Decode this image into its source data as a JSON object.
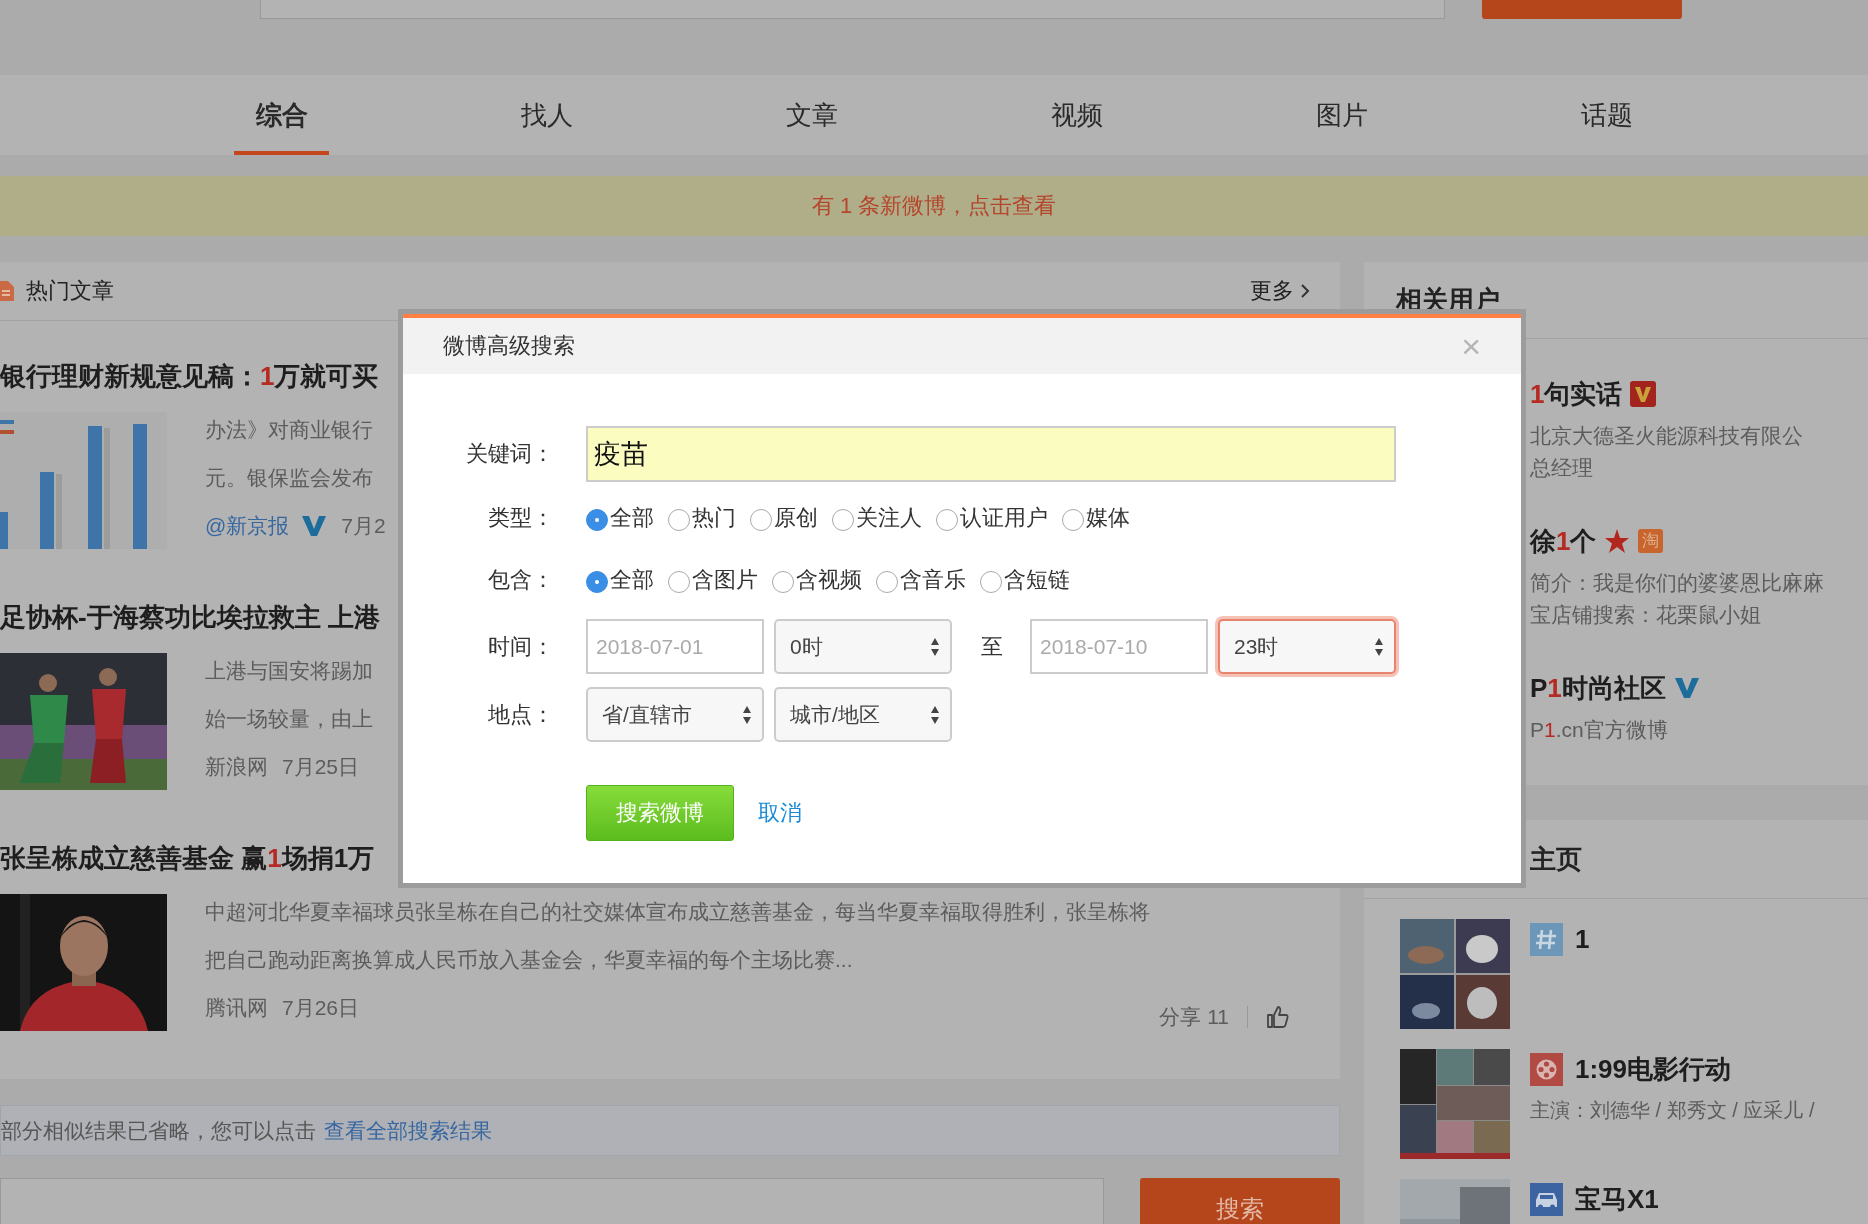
{
  "tabs": [
    {
      "label": "综合",
      "selected": true
    },
    {
      "label": "找人",
      "selected": false
    },
    {
      "label": "文章",
      "selected": false
    },
    {
      "label": "视频",
      "selected": false
    },
    {
      "label": "图片",
      "selected": false
    },
    {
      "label": "话题",
      "selected": false
    }
  ],
  "notice": "有 1 条新微博，点击查看",
  "hot_articles": {
    "title": "热门文章",
    "more": "更多",
    "articles": [
      {
        "title_parts": [
          {
            "text": "银行理财新规意见稿：",
            "highlight": false
          },
          {
            "text": "1",
            "highlight": true
          },
          {
            "text": "万就可买",
            "highlight": false
          }
        ],
        "summary": [
          "办法》对商业银行",
          "元。银保监会发布"
        ],
        "source": {
          "text": "@新京报",
          "kind": "link"
        },
        "verified": true,
        "date": "7月2"
      },
      {
        "title_parts": [
          {
            "text": "足协杯-于海蔡功比埃拉救主 上港",
            "highlight": false
          }
        ],
        "summary": [
          "上港与国安将踢加",
          "始一场较量，由上"
        ],
        "source": {
          "text": "新浪网",
          "kind": "plain"
        },
        "verified": false,
        "date": "7月25日"
      },
      {
        "title_parts": [
          {
            "text": "张呈栋成立慈善基金 赢",
            "highlight": false
          },
          {
            "text": "1",
            "highlight": true
          },
          {
            "text": "场捐1万",
            "highlight": false
          }
        ],
        "summary": [
          "中超河北华夏幸福球员张呈栋在自己的社交媒体宣布成立慈善基金，每当华夏幸福取得胜利，张呈栋将",
          "把自己跑动距离换算成人民币放入基金会，华夏幸福的每个主场比赛..."
        ],
        "source": {
          "text": "腾讯网",
          "kind": "plain"
        },
        "verified": false,
        "date": "7月26日",
        "share": "分享 11"
      }
    ]
  },
  "omitted": {
    "text": "部分相似结果已省略，您可以点击",
    "link": "查看全部搜索结果"
  },
  "bottom_search": {
    "button": "搜索"
  },
  "related_users": {
    "title": "相关用户",
    "users": [
      {
        "name_parts": [
          {
            "text": "1",
            "highlight": true
          },
          {
            "text": "句实话",
            "highlight": false
          }
        ],
        "badges": [
          {
            "kind": "vip"
          }
        ],
        "info": [
          {
            "parts": [
              {
                "text": "北京大德圣火能源科技有限公",
                "highlight": false
              }
            ]
          },
          {
            "parts": [
              {
                "text": "总经理",
                "highlight": false
              }
            ]
          }
        ]
      },
      {
        "name_parts": [
          {
            "text": "徐",
            "highlight": false
          },
          {
            "text": "1",
            "highlight": true
          },
          {
            "text": "个",
            "highlight": false
          }
        ],
        "badges": [
          {
            "kind": "star"
          },
          {
            "kind": "shop",
            "text": "淘"
          }
        ],
        "info": [
          {
            "parts": [
              {
                "text": "简介：我是你们的婆婆恩比麻麻",
                "highlight": false
              }
            ]
          },
          {
            "parts": [
              {
                "text": "宝店铺搜索：花栗鼠小姐",
                "highlight": false
              }
            ]
          }
        ]
      },
      {
        "name_parts": [
          {
            "text": "P",
            "highlight": false
          },
          {
            "text": "1",
            "highlight": true
          },
          {
            "text": "时尚社区",
            "highlight": false
          }
        ],
        "badges": [
          {
            "kind": "verified"
          }
        ],
        "info": [
          {
            "parts": [
              {
                "text": "P",
                "highlight": false
              },
              {
                "text": "1",
                "highlight": true
              },
              {
                "text": ".cn官方微博",
                "highlight": false
              }
            ]
          }
        ]
      }
    ]
  },
  "pages": {
    "title": "主页",
    "items": [
      {
        "kind": "topic",
        "title": "1"
      },
      {
        "kind": "film",
        "title": "1:99电影行动",
        "subtitle": "主演：刘德华 / 郑秀文 / 应采儿 /"
      },
      {
        "kind": "car",
        "title": "宝马X1"
      }
    ]
  },
  "dialog": {
    "title": "微博高级搜索",
    "close": "×",
    "keyword": {
      "label": "关键词：",
      "value": "疫苗"
    },
    "type": {
      "label": "类型：",
      "options": [
        {
          "label": "全部",
          "selected": true
        },
        {
          "label": "热门",
          "selected": false
        },
        {
          "label": "原创",
          "selected": false
        },
        {
          "label": "关注人",
          "selected": false
        },
        {
          "label": "认证用户",
          "selected": false
        },
        {
          "label": "媒体",
          "selected": false
        }
      ]
    },
    "include": {
      "label": "包含：",
      "options": [
        {
          "label": "全部",
          "selected": true
        },
        {
          "label": "含图片",
          "selected": false
        },
        {
          "label": "含视频",
          "selected": false
        },
        {
          "label": "含音乐",
          "selected": false
        },
        {
          "label": "含短链",
          "selected": false
        }
      ]
    },
    "time": {
      "label": "时间：",
      "start_date": {
        "placeholder": "2018-07-01"
      },
      "start_hour": {
        "value": "0时",
        "focused": false
      },
      "separator": "至",
      "end_date": {
        "placeholder": "2018-07-10"
      },
      "end_hour": {
        "value": "23时",
        "focused": true
      }
    },
    "place": {
      "label": "地点：",
      "province": "省/直辖市",
      "city": "城市/地区"
    },
    "submit": "搜索微博",
    "cancel": "取消"
  }
}
